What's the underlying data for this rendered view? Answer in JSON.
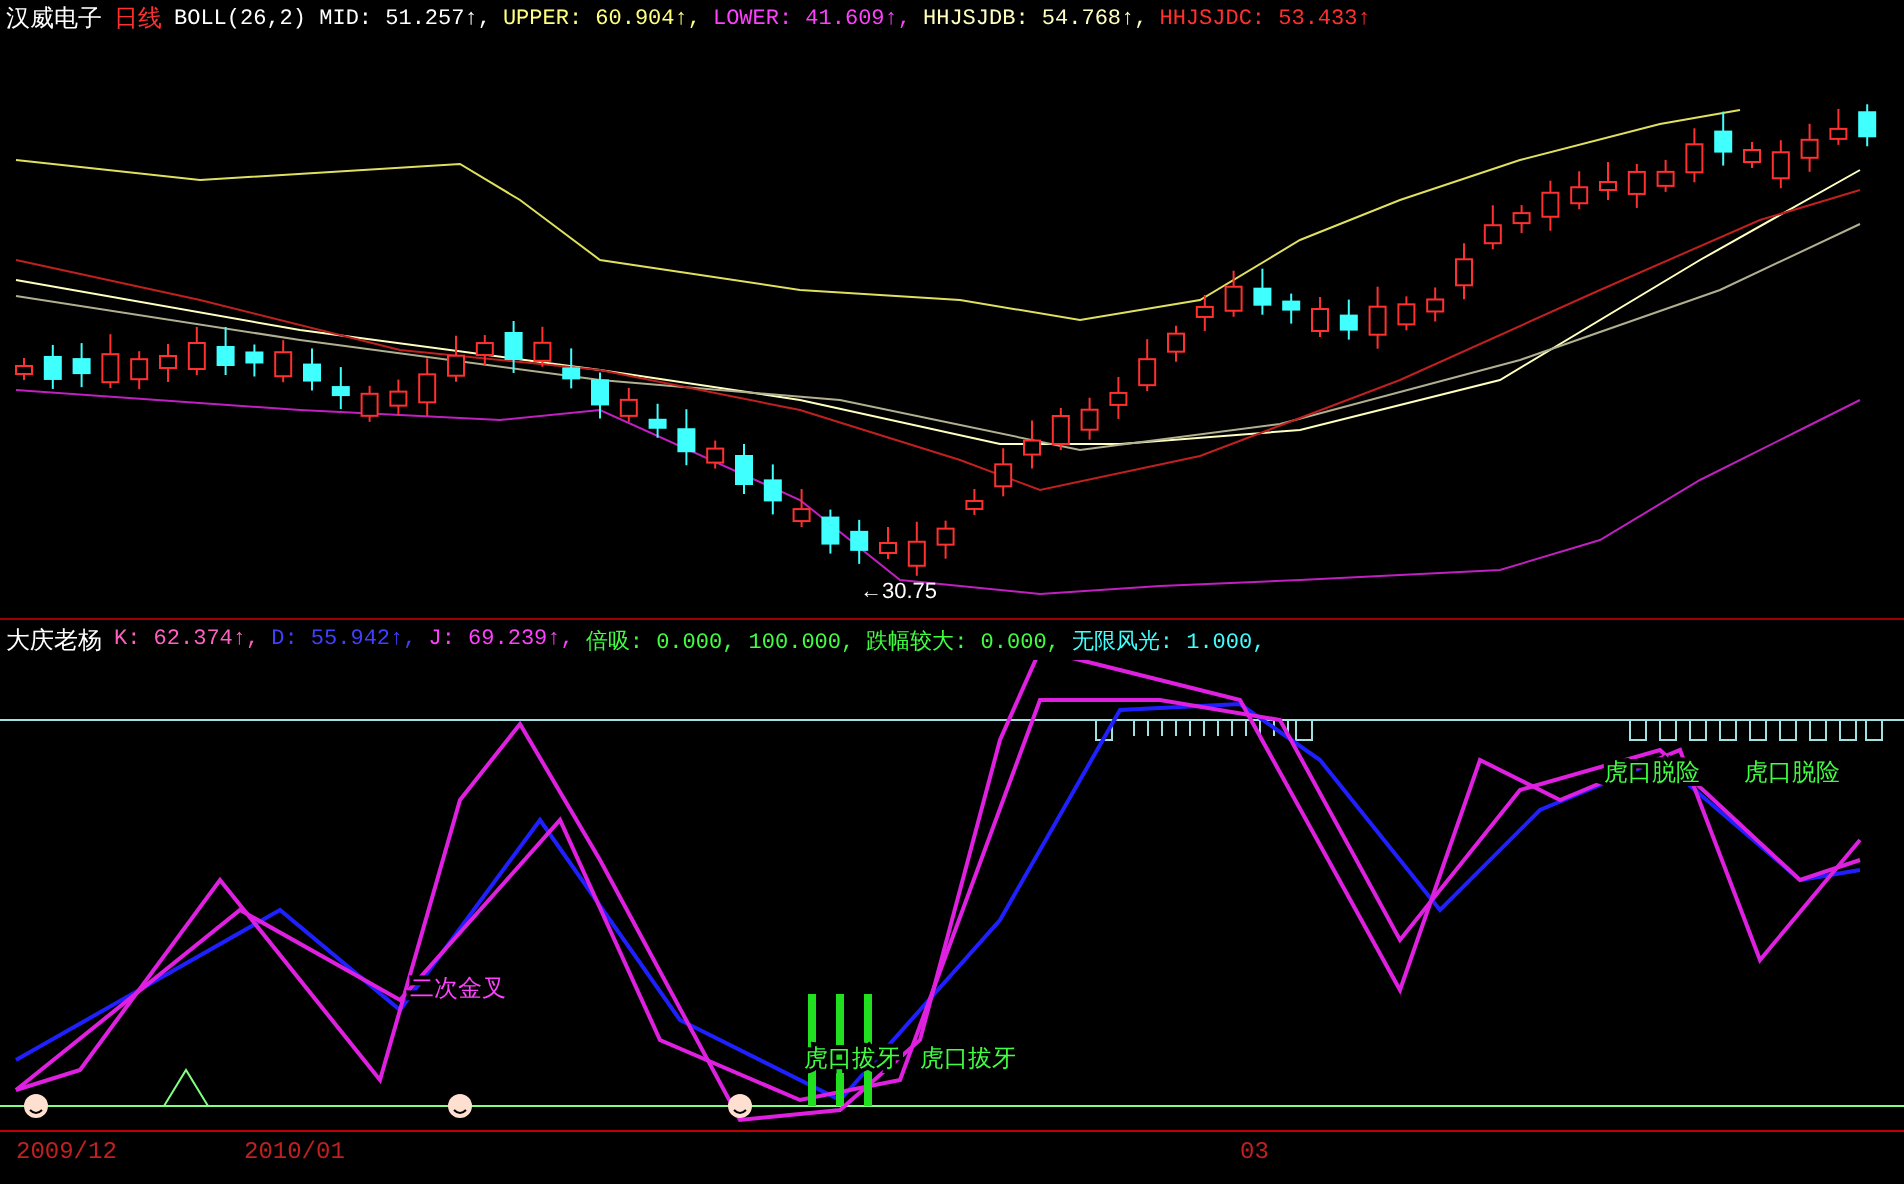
{
  "stock": {
    "name": "汉威电子",
    "period": "日线"
  },
  "price_readings": [
    {
      "text": "BOLL(26,2) MID: 51.257↑,",
      "color": "#ffffff"
    },
    {
      "text": "UPPER: 60.904↑,",
      "color": "#ffff80"
    },
    {
      "text": "LOWER: 41.609↑,",
      "color": "#ff40ff"
    },
    {
      "text": "HHJSJDB: 54.768↑,",
      "color": "#ffffc0"
    },
    {
      "text": "HHJSJDC: 53.433↑",
      "color": "#ff3030"
    }
  ],
  "price_annotation": "←30.75",
  "oscillator": {
    "name": "大庆老杨",
    "readings": [
      {
        "text": "K: 62.374↑,",
        "color": "#ff60c0"
      },
      {
        "text": "D: 55.942↑,",
        "color": "#4040ff"
      },
      {
        "text": "J: 69.239↑,",
        "color": "#ff40ff"
      },
      {
        "text": "倍吸: 0.000, 100.000,",
        "color": "#40ff40"
      },
      {
        "text": "跌幅较大: 0.000,",
        "color": "#40ff40"
      },
      {
        "text": "无限风光: 1.000,",
        "color": "#40ffff"
      }
    ]
  },
  "signals": [
    {
      "text": "二次金叉",
      "color": "#ff40ff"
    },
    {
      "text": "虎口拔牙",
      "color": "#40ff40"
    },
    {
      "text": "虎口拔牙",
      "color": "#40ff40"
    },
    {
      "text": "虎口脱险",
      "color": "#40ff40"
    },
    {
      "text": "虎口脱险",
      "color": "#40ff40"
    }
  ],
  "dates": [
    "2009/12",
    "2010/01",
    "03"
  ]
}
